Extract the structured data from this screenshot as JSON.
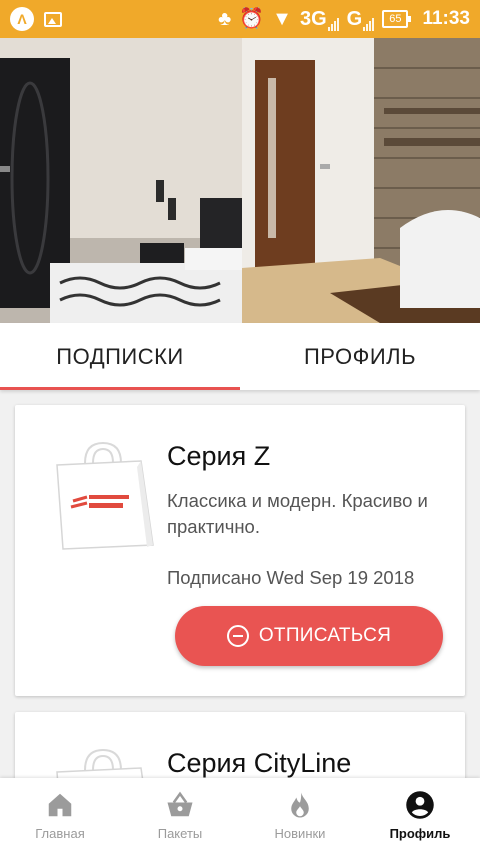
{
  "status_bar": {
    "left_icons": [
      "app-logo-icon",
      "image-icon"
    ],
    "icons": [
      "tree-icon",
      "alarm-icon",
      "wifi-icon",
      "signal-icon"
    ],
    "network1": "3G",
    "network2": "G",
    "battery": "65",
    "time": "11:33"
  },
  "tabs": [
    {
      "label": "ПОДПИСКИ",
      "active": true
    },
    {
      "label": "ПРОФИЛЬ",
      "active": false
    }
  ],
  "subscriptions": [
    {
      "title": "Серия Z",
      "description": "Классика и модерн. Красиво и практично.",
      "date": "Подписано Wed Sep 19 2018",
      "button": "ОТПИСАТЬСЯ",
      "image_icon": "shopping-bag-icon"
    },
    {
      "title": "Серия CityLine",
      "image_icon": "shopping-bag-icon"
    }
  ],
  "bottom_nav": [
    {
      "label": "Главная",
      "icon": "home-icon",
      "active": false
    },
    {
      "label": "Пакеты",
      "icon": "basket-icon",
      "active": false
    },
    {
      "label": "Новинки",
      "icon": "flame-icon",
      "active": false
    },
    {
      "label": "Профиль",
      "icon": "account-icon",
      "active": true
    }
  ],
  "colors": {
    "status_bar": "#f0a92a",
    "accent": "#e95452",
    "nav_inactive": "#9b9b9b"
  }
}
